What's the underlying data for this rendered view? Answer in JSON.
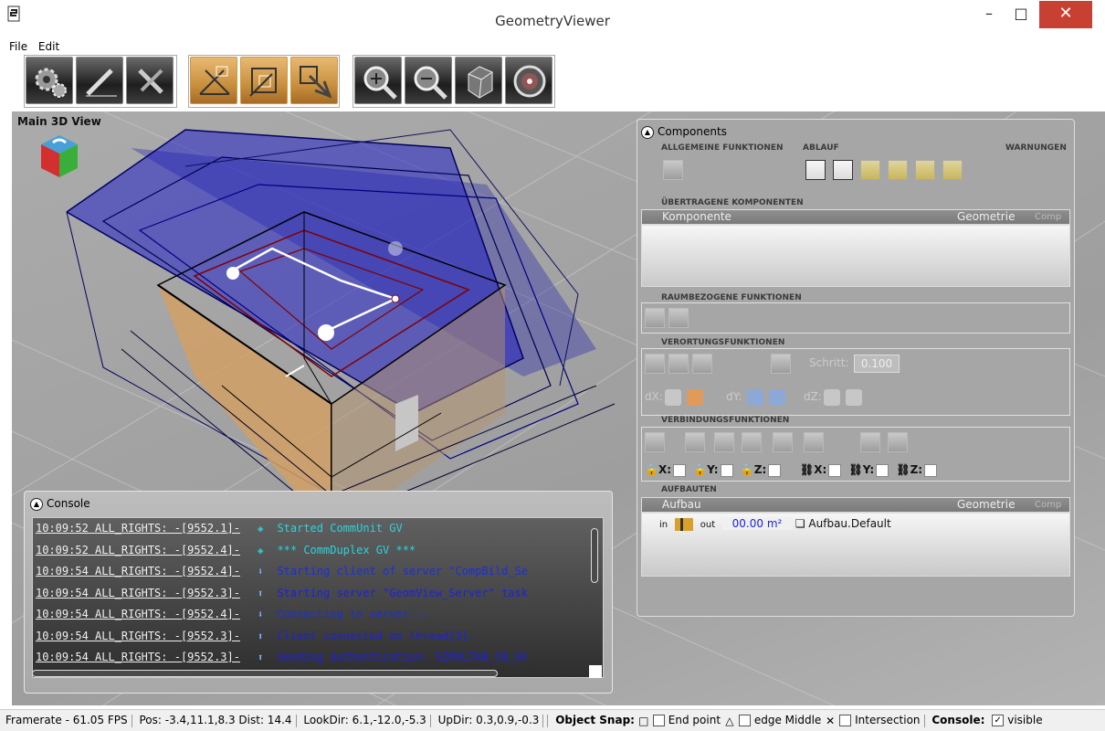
{
  "window": {
    "title": "GeometryViewer",
    "minimize": "–",
    "maximize": "□",
    "close": "✕"
  },
  "menu": {
    "items": [
      "File",
      "Edit"
    ]
  },
  "toolbar": {
    "buttons": [
      "settings-gears",
      "edit-pencil",
      "tools-wrench",
      "geometry-edit",
      "geometry-select",
      "object-transform",
      "zoom-in",
      "zoom-out",
      "camera-view",
      "compass-clock"
    ],
    "selected": [
      "geometry-edit",
      "geometry-select",
      "object-transform"
    ]
  },
  "viewport": {
    "title": "Main 3D View"
  },
  "console": {
    "title": "Console",
    "lines": [
      {
        "stamp": "10:09:52 ALL_RIGHTS: -[9552.1]-",
        "icon": "diamond-double",
        "color": "#27d5dd",
        "msg": "Started CommUnit GV"
      },
      {
        "stamp": "10:09:52 ALL_RIGHTS: -[9552.4]-",
        "icon": "diamond-double",
        "color": "#27d5dd",
        "msg": "*** CommDuplex GV ***"
      },
      {
        "stamp": "10:09:54 ALL_RIGHTS: -[9552.4]-",
        "icon": "arrow-down",
        "color": "#1a2fdc",
        "msg": "Starting client of server \"CompBild_Se"
      },
      {
        "stamp": "10:09:54 ALL_RIGHTS: -[9552.3]-",
        "icon": "arrow-up",
        "color": "#1d22dd",
        "msg": "Starting server \"GeomView_Server\" task"
      },
      {
        "stamp": "10:09:54 ALL_RIGHTS: -[9552.4]-",
        "icon": "arrow-down",
        "color": "#1a2fdc",
        "msg": "Connecting to server..."
      },
      {
        "stamp": "10:09:54 ALL_RIGHTS: -[9552.3]-",
        "icon": "arrow-up",
        "color": "#1d22dd",
        "msg": "Client connected on thread[3]."
      },
      {
        "stamp": "10:09:54 ALL_RIGHTS: -[9552.3]-",
        "icon": "arrow-up",
        "color": "#1d22dd",
        "msg": "Sending authentication: SIMULTAN_CB_GV"
      }
    ]
  },
  "components": {
    "title": "Components",
    "allgemeine": "ALLGEMEINE FUNKTIONEN",
    "ablauf": "ABLAUF",
    "warnungen": "WARNUNGEN",
    "uebertragen": "ÜBERTRAGENE KOMPONENTEN",
    "col_komponente": "Komponente",
    "col_geometrie": "Geometrie",
    "col_comp": "Comp",
    "raumbezogen": "RAUMBEZOGENE FUNKTIONEN",
    "verortung": "VERORTUNGSFUNKTIONEN",
    "schritt_label": "Schritt:",
    "schritt_value": "0.100",
    "dx": "dX:",
    "dy": "dY:",
    "dz": "dZ:",
    "verbindung": "VERBINDUNGSFUNKTIONEN",
    "lock_x": "X:",
    "lock_y": "Y:",
    "lock_z": "Z:",
    "link_x": "X:",
    "link_y": "Y:",
    "link_z": "Z:",
    "aufbauten": "AUFBAUTEN",
    "col_aufbau": "Aufbau",
    "aufbau_in": "in",
    "aufbau_out": "out",
    "aufbau_area": "00.00 m²",
    "aufbau_name": "Aufbau.Default"
  },
  "status": {
    "framerate": "Framerate - 61.05 FPS",
    "pos": "Pos: -3.4,11.1,8.3",
    "dist": "Dist: 14.4",
    "lookdir": "LookDir: 6.1,-12.0,-5.3",
    "updir": "UpDir: 0.3,0.9,-0.3",
    "snap_label": "Object Snap:",
    "snap_end": "End point",
    "snap_edge": "edge Middle",
    "snap_intersection": "Intersection",
    "console_label": "Console:",
    "console_visible": "visible"
  }
}
